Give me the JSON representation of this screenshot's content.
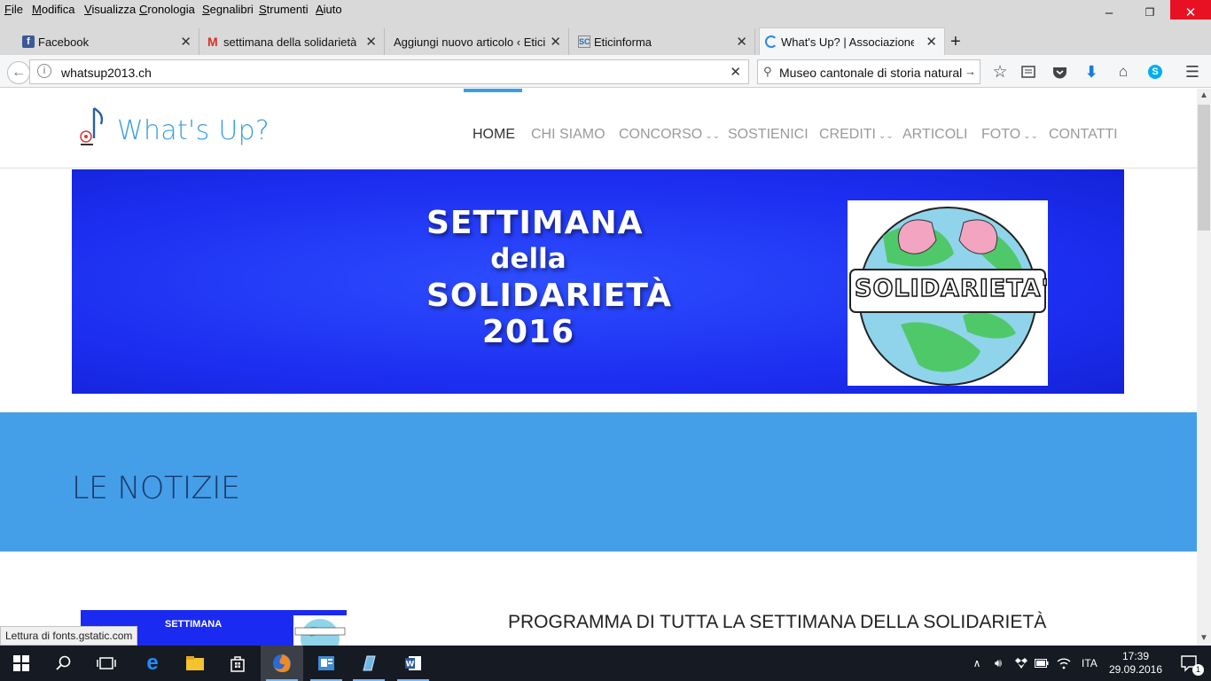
{
  "menubar": {
    "items": [
      "File",
      "Modifica",
      "Visualizza",
      "Cronologia",
      "Segnalibri",
      "Strumenti",
      "Aiuto"
    ]
  },
  "window_controls": {
    "minimize": "–",
    "restore": "❐",
    "close": "✕"
  },
  "tabs": [
    {
      "title": "Facebook",
      "icon": "facebook-icon",
      "active": false
    },
    {
      "title": "settimana della solidarietà...",
      "icon": "gmail-icon",
      "active": false
    },
    {
      "title": "Aggiungi nuovo articolo ‹ Etici...",
      "icon": "none",
      "active": false
    },
    {
      "title": "Eticinforma",
      "icon": "eticinforma-icon",
      "active": false
    },
    {
      "title": "What's Up? | Associazione",
      "icon": "loading-icon",
      "active": true
    }
  ],
  "new_tab_label": "+",
  "address": {
    "url": "whatsup2013.ch"
  },
  "search": {
    "value": "Museo cantonale di storia naturale"
  },
  "site": {
    "logo_text": "What's Up?",
    "nav": [
      {
        "label": "HOME",
        "dropdown": false,
        "active": true
      },
      {
        "label": "CHI SIAMO",
        "dropdown": false,
        "active": false
      },
      {
        "label": "CONCORSO",
        "dropdown": true,
        "active": false
      },
      {
        "label": "SOSTIENICI",
        "dropdown": false,
        "active": false
      },
      {
        "label": "CREDITI",
        "dropdown": true,
        "active": false
      },
      {
        "label": "ARTICOLI",
        "dropdown": false,
        "active": false
      },
      {
        "label": "FOTO",
        "dropdown": true,
        "active": false
      },
      {
        "label": "CONTATTI",
        "dropdown": false,
        "active": false
      }
    ],
    "hero": {
      "lines": [
        "SETTIMANA",
        "della",
        "SOLIDARIETÀ",
        "2016"
      ],
      "globe_banner_text": "SOLIDARIETA'"
    },
    "news_title": "LE NOTIZIE",
    "article": {
      "title": "PROGRAMMA DI TUTTA LA SETTIMANA DELLA SOLIDARIETÀ",
      "thumb_text": "SETTIMANA"
    }
  },
  "status_text": "Lettura di fonts.gstatic.com",
  "taskbar": {
    "language": "ITA",
    "time": "17:39",
    "date": "29.09.2016",
    "notifications": "1"
  },
  "colors": {
    "brand_blue": "#3a9ee4",
    "hero_blue": "#1c2ef0",
    "news_band": "#449fe8",
    "close_red": "#e81123"
  }
}
